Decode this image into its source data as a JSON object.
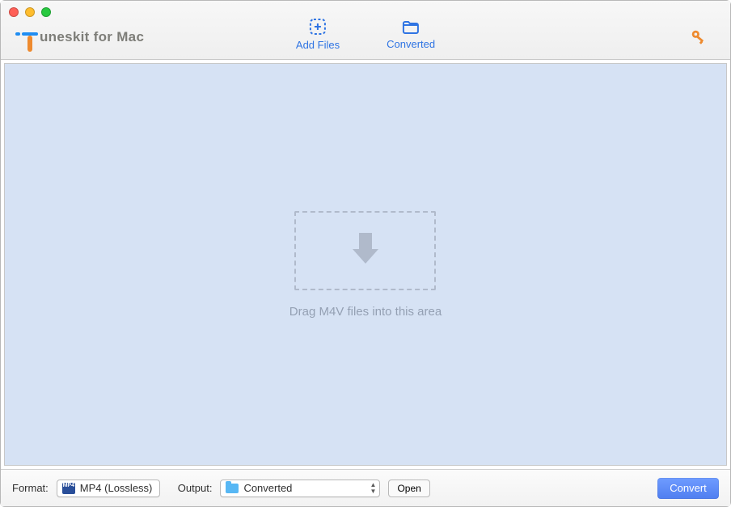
{
  "app": {
    "logo_text_suffix": "uneskit for Mac"
  },
  "toolbar": {
    "add_files": "Add Files",
    "converted": "Converted"
  },
  "main": {
    "drop_hint": "Drag M4V files into this area"
  },
  "bottom": {
    "format_label": "Format:",
    "format_value": "MP4 (Lossless)",
    "output_label": "Output:",
    "output_value": "Converted",
    "open_label": "Open",
    "convert_label": "Convert"
  }
}
